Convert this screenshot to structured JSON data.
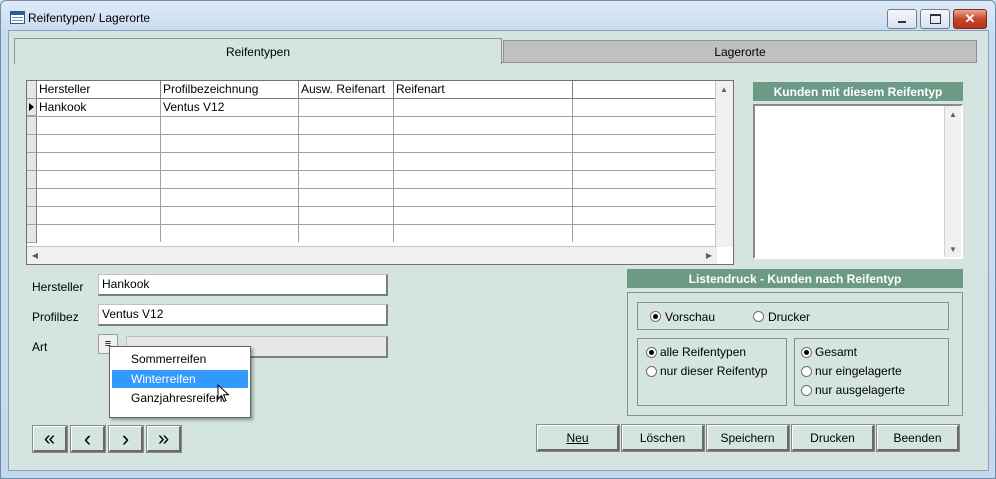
{
  "window": {
    "title": "Reifentypen/ Lagerorte",
    "controls": [
      "minimize",
      "maximize",
      "close"
    ]
  },
  "tabs": [
    {
      "label": "Reifentypen",
      "active": true
    },
    {
      "label": "Lagerorte",
      "active": false
    }
  ],
  "grid": {
    "columns": [
      "Hersteller",
      "Profilbezeichnung",
      "Ausw. Reifenart",
      "Reifenart",
      ""
    ],
    "rows": [
      [
        "Hankook",
        "Ventus V12",
        "",
        "",
        ""
      ]
    ],
    "empty_rows": 7
  },
  "form": {
    "hersteller_label": "Hersteller",
    "hersteller_value": "Hankook",
    "profilbez_label": "Profilbez",
    "profilbez_value": "Ventus V12",
    "art_label": "Art",
    "art_value": "",
    "art_options": [
      "Sommerreifen",
      "Winterreifen",
      "Ganzjahresreifen"
    ],
    "art_highlighted": "Winterreifen"
  },
  "customers_panel": {
    "title": "Kunden mit diesem Reifentyp"
  },
  "print_panel": {
    "title": "Listendruck - Kunden nach Reifentyp",
    "output": {
      "options": [
        "Vorschau",
        "Drucker"
      ],
      "selected": "Vorschau"
    },
    "type_scope": {
      "options": [
        "alle Reifentypen",
        "nur dieser Reifentyp"
      ],
      "selected": "alle Reifentypen"
    },
    "stock_scope": {
      "options": [
        "Gesamt",
        "nur eingelagerte",
        "nur ausgelagerte"
      ],
      "selected": "Gesamt"
    }
  },
  "nav_buttons": [
    "«",
    "‹",
    "›",
    "»"
  ],
  "actions": {
    "neu": "Neu",
    "loeschen": "Löschen",
    "speichern": "Speichern",
    "drucken": "Drucken",
    "beenden": "Beenden"
  }
}
